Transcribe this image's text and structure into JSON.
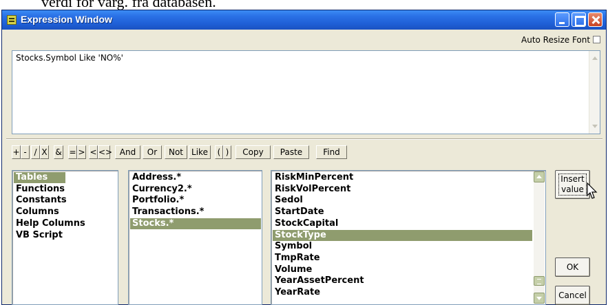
{
  "page_caption": "verdi for varg. fra databasen.",
  "window": {
    "title": "Expression Window",
    "auto_resize_label": "Auto Resize Font",
    "auto_resize_checked": false
  },
  "expression": {
    "text": "Stocks.Symbol Like 'NO%'"
  },
  "operators": [
    "+",
    "-",
    "/",
    "X",
    "&",
    "=",
    ">",
    "<",
    "<>",
    "And",
    "Or",
    "Not",
    "Like",
    "(",
    ")",
    "Copy",
    "Paste",
    "Find"
  ],
  "categories": {
    "items": [
      "Tables",
      "Functions",
      "Constants",
      "Columns",
      "Help Columns",
      "VB Script"
    ],
    "selected_index": 0
  },
  "tables": {
    "items": [
      "Address.*",
      "Currency2.*",
      "Portfolio.*",
      "Transactions.*",
      "Stocks.*"
    ],
    "selected_index": 4
  },
  "columns": {
    "items": [
      "RiskMinPercent",
      "RiskVolPercent",
      "Sedol",
      "StartDate",
      "StockCapital",
      "StockType",
      "Symbol",
      "TmpRate",
      "Volume",
      "YearAssetPercent",
      "YearRate"
    ],
    "selected_index": 5
  },
  "buttons": {
    "insert_line1": "Insert",
    "insert_line2": "value",
    "ok": "OK",
    "cancel": "Cancel"
  },
  "colors": {
    "selection": "#8f9c6e",
    "titlebar": "#2a71e6",
    "dialog_bg": "#ece9d8"
  }
}
